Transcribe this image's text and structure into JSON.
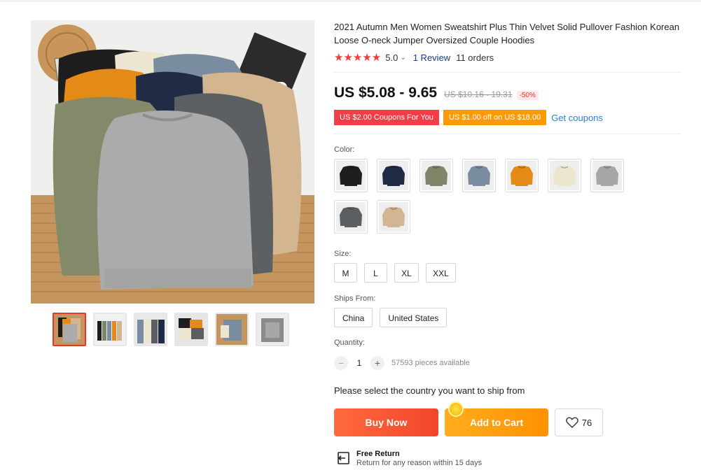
{
  "product": {
    "title": "2021 Autumn Men Women Sweatshirt Plus Thin Velvet Solid Pullover Fashion Korean Loose O-neck Jumper Oversized Couple Hoodies",
    "rating": {
      "stars": "★★★★★",
      "score": "5.0",
      "caret": "⌄",
      "reviews": "1 Review",
      "orders": "11 orders"
    },
    "price": {
      "current": "US $5.08 - 9.65",
      "original": "US $10.16 - 19.31",
      "discount": "-50%"
    },
    "coupons": {
      "coupon1": "US $2.00 Coupons For You",
      "coupon2": "US $1.00 off on US $18.00",
      "get_coupons": "Get coupons"
    },
    "color": {
      "label": "Color:",
      "swatches": [
        {
          "name": "black",
          "hex": "#1e1e1e"
        },
        {
          "name": "navy",
          "hex": "#1f2a44"
        },
        {
          "name": "army green",
          "hex": "#7f8668"
        },
        {
          "name": "blue grey",
          "hex": "#7a8da0"
        },
        {
          "name": "orange",
          "hex": "#e48a16"
        },
        {
          "name": "cream",
          "hex": "#ede6cf"
        },
        {
          "name": "light grey",
          "hex": "#a7a7a7"
        },
        {
          "name": "dark grey",
          "hex": "#5b5f61"
        },
        {
          "name": "khaki",
          "hex": "#d2b592"
        }
      ]
    },
    "size": {
      "label": "Size:",
      "options": [
        "M",
        "L",
        "XL",
        "XXL"
      ]
    },
    "ships_from": {
      "label": "Ships From:",
      "options": [
        "China",
        "United States"
      ]
    },
    "quantity": {
      "label": "Quantity:",
      "minus": "−",
      "value": "1",
      "plus": "+",
      "available": "57593 pieces available"
    },
    "ship_note": "Please select the country you want to ship from",
    "actions": {
      "buy_now": "Buy Now",
      "add_to_cart": "Add to Cart",
      "wishlist_count": "76"
    },
    "return_policy": {
      "title": "Free Return",
      "subtitle": "Return for any reason within 15 days"
    }
  },
  "colors": {
    "accent_red": "#e3372b",
    "buy_now": "#f2452b",
    "add_to_cart": "#ff9100",
    "link_blue": "#2b7fd1",
    "star_red": "#f23c3c"
  },
  "icons": {
    "star": "star-icon",
    "heart": "heart-icon",
    "return": "return-icon"
  }
}
